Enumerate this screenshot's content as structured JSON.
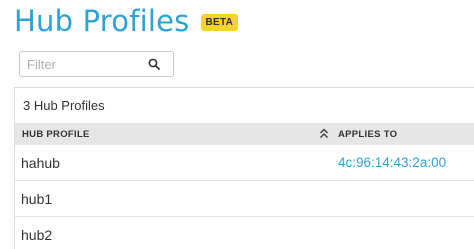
{
  "header": {
    "title": "Hub Profiles",
    "badge": "BETA"
  },
  "filter": {
    "placeholder": "Filter",
    "value": ""
  },
  "summary": {
    "count_text": "3 Hub Profiles"
  },
  "table": {
    "columns": [
      {
        "label": "HUB PROFILE"
      },
      {
        "label": "APPLIES TO",
        "sort": "ascending"
      }
    ],
    "rows": [
      {
        "name": "hahub",
        "applies_to": "4c:96:14:43:2a:00"
      },
      {
        "name": "hub1",
        "applies_to": ""
      },
      {
        "name": "hub2",
        "applies_to": ""
      }
    ]
  },
  "colors": {
    "accent": "#2ba3d9",
    "badge": "#f5d327",
    "header_bg": "#e6e6e6"
  }
}
